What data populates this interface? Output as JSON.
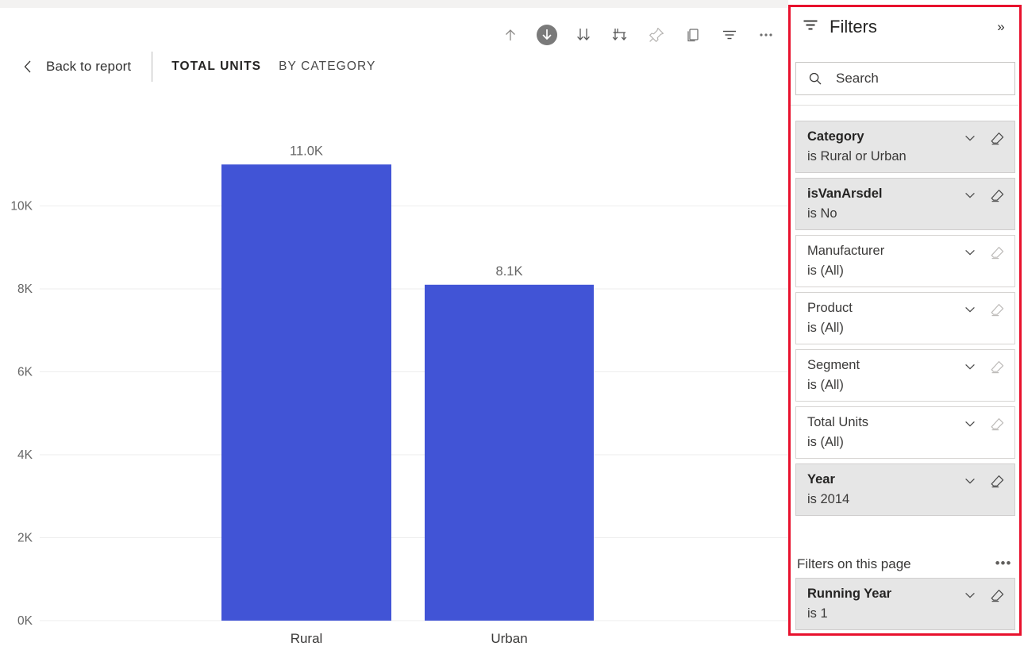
{
  "toolbar": {
    "buttons": [
      {
        "name": "export-up-icon",
        "label": "Export"
      },
      {
        "name": "download-circle-icon",
        "label": "Download"
      },
      {
        "name": "sort-descending-icon",
        "label": "Sort descending"
      },
      {
        "name": "drill-down-icon",
        "label": "Drill down"
      },
      {
        "name": "pin-icon",
        "label": "Pin visual"
      },
      {
        "name": "copy-icon",
        "label": "Copy visual"
      },
      {
        "name": "filter-icon",
        "label": "Filters"
      },
      {
        "name": "more-options-icon",
        "label": "More options"
      }
    ]
  },
  "nav": {
    "back_label": "Back to report",
    "title_main": "TOTAL UNITS",
    "title_sub": "BY CATEGORY"
  },
  "chart_data": {
    "type": "bar",
    "title": "TOTAL UNITS BY CATEGORY",
    "categories": [
      "Rural",
      "Urban"
    ],
    "values": [
      11000,
      8100
    ],
    "data_labels": [
      "11.0K",
      "8.1K"
    ],
    "xlabel": "",
    "ylabel": "",
    "ylim": [
      0,
      12000
    ],
    "ytick_labels": [
      "0K",
      "2K",
      "4K",
      "6K",
      "8K",
      "10K"
    ],
    "ytick_values": [
      0,
      2000,
      4000,
      6000,
      8000,
      10000
    ],
    "grid": true,
    "legend": "none",
    "bar_color": "#4154d6",
    "gridline_color": "#eeeeee",
    "axis_text_color": "#666666"
  },
  "filters": {
    "panel_title": "Filters",
    "expand_icon": "»",
    "search": {
      "placeholder": "Search",
      "value": ""
    },
    "cards": [
      {
        "name": "Category",
        "value": "is Rural or Urban",
        "active": true
      },
      {
        "name": "isVanArsdel",
        "value": "is No",
        "active": true
      },
      {
        "name": "Manufacturer",
        "value": "is (All)",
        "active": false
      },
      {
        "name": "Product",
        "value": "is (All)",
        "active": false
      },
      {
        "name": "Segment",
        "value": "is (All)",
        "active": false
      },
      {
        "name": "Total Units",
        "value": "is (All)",
        "active": false
      },
      {
        "name": "Year",
        "value": "is 2014",
        "active": true
      }
    ],
    "page_section": {
      "title": "Filters on this page",
      "more_label": "•••",
      "cards": [
        {
          "name": "Running Year",
          "value": "is 1",
          "active": true
        }
      ]
    },
    "highlight_color": "#e8112d"
  }
}
